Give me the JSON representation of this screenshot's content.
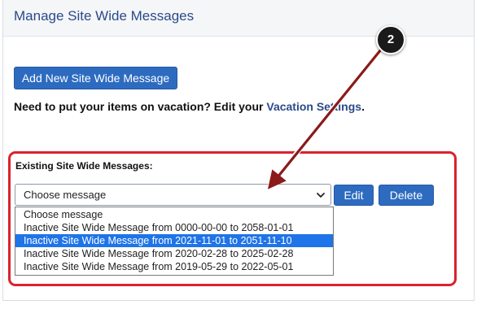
{
  "header": {
    "title": "Manage Site Wide Messages"
  },
  "actions": {
    "add_label": "Add New Site Wide Message"
  },
  "vacation": {
    "prefix": "Need to put your items on vacation? Edit your ",
    "link": "Vacation Settings",
    "suffix": "."
  },
  "existing": {
    "label": "Existing Site Wide Messages:",
    "select_value": "Choose message",
    "edit_label": "Edit",
    "delete_label": "Delete",
    "options": [
      "Choose message",
      "Inactive Site Wide Message from 0000-00-00 to 2058-01-01",
      "Inactive Site Wide Message from 2021-11-01 to 2051-11-10",
      "Inactive Site Wide Message from 2020-02-28 to 2025-02-28",
      "Inactive Site Wide Message from 2019-05-29 to 2022-05-01"
    ],
    "selected_index": 2
  },
  "annotation": {
    "step_number": "2",
    "arrow_color": "#8b1a1a",
    "highlight_color": "#d9232d"
  },
  "colors": {
    "primary_button": "#2d6bc0",
    "title_text": "#2a4a8a",
    "selected_option": "#1e74e8"
  }
}
